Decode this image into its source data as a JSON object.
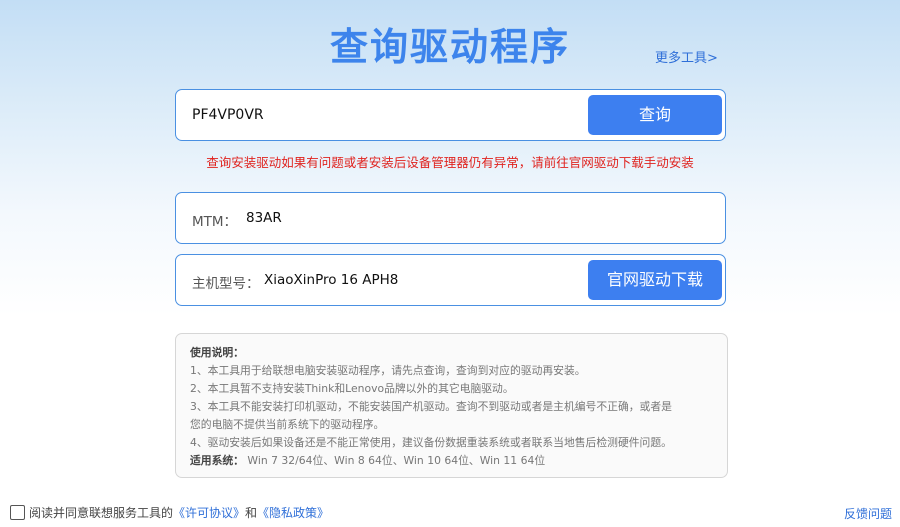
{
  "header": {
    "title": "查询驱动程序",
    "more_tools": "更多工具>"
  },
  "search": {
    "value": "PF4VP0VR",
    "button_label": "查询"
  },
  "warning": "查询安装驱动如果有问题或者安装后设备管理器仍有异常，请前往官网驱动下载手动安装",
  "mtm": {
    "label": "MTM：",
    "value": "83AR"
  },
  "model": {
    "label": "主机型号：",
    "value": "XiaoXinPro 16 APH8",
    "download_button": "官网驱动下载"
  },
  "instructions": {
    "heading": "使用说明：",
    "lines": [
      "1、本工具用于给联想电脑安装驱动程序，请先点查询，查询到对应的驱动再安装。",
      "2、本工具暂不支持安装Think和Lenovo品牌以外的其它电脑驱动。",
      "3、本工具不能安装打印机驱动，不能安装国产机驱动。查询不到驱动或者是主机编号不正确，或者是",
      "您的电脑不提供当前系统下的驱动程序。",
      "4、驱动安装后如果设备还是不能正常使用，建议备份数据重装系统或者联系当地售后检测硬件问题。"
    ],
    "systems_label": "适用系统：",
    "systems_value": "Win 7 32/64位、Win 8 64位、Win 10 64位、Win 11 64位"
  },
  "footer": {
    "agree_prefix": "阅读并同意联想服务工具的",
    "license_link": "《许可协议》",
    "and": "和",
    "privacy_link": "《隐私政策》",
    "agreed": false,
    "feedback": "反馈问题"
  },
  "colors": {
    "accent": "#3d7ff0",
    "title": "#3d84ec",
    "warning": "#e0231f",
    "link": "#2f6fd8"
  }
}
